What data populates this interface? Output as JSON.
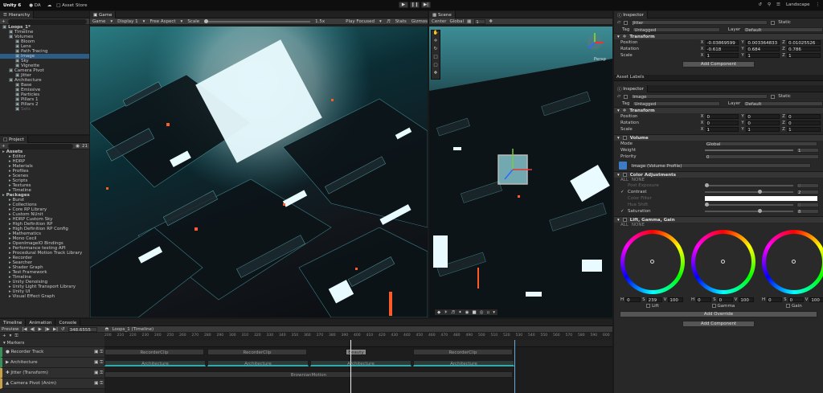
{
  "topbar": {
    "title": "Unity 6",
    "account": "DA",
    "asset_store": "Asset Store",
    "layout": "Landscape"
  },
  "hierarchy": {
    "tab": "Hierarchy",
    "rows": [
      {
        "label": "Loops_1*",
        "indent": 0,
        "bold": true
      },
      {
        "label": "Timeline",
        "indent": 1
      },
      {
        "label": "Volumes",
        "indent": 1
      },
      {
        "label": "Bloom",
        "indent": 2
      },
      {
        "label": "Lens",
        "indent": 2
      },
      {
        "label": "Path Tracing",
        "indent": 2
      },
      {
        "label": "Image",
        "indent": 2,
        "selected": true
      },
      {
        "label": "Sky",
        "indent": 2
      },
      {
        "label": "Vignette",
        "indent": 2
      },
      {
        "label": "Camera Pivot",
        "indent": 1
      },
      {
        "label": "Jitter",
        "indent": 2
      },
      {
        "label": "Architecture",
        "indent": 1
      },
      {
        "label": "Base",
        "indent": 2
      },
      {
        "label": "Emissive",
        "indent": 2
      },
      {
        "label": "Particles",
        "indent": 2
      },
      {
        "label": "Pillars 1",
        "indent": 2
      },
      {
        "label": "Pillars 2",
        "indent": 2
      },
      {
        "label": "Sets",
        "indent": 2,
        "dim": true
      }
    ]
  },
  "project": {
    "tab": "Project",
    "count": "21",
    "rows": [
      {
        "label": "Assets",
        "indent": 0,
        "bold": true
      },
      {
        "label": "Editor",
        "indent": 1
      },
      {
        "label": "HDRP",
        "indent": 1
      },
      {
        "label": "Materials",
        "indent": 1
      },
      {
        "label": "Profiles",
        "indent": 1
      },
      {
        "label": "Scenes",
        "indent": 1
      },
      {
        "label": "Scripts",
        "indent": 1
      },
      {
        "label": "Textures",
        "indent": 1
      },
      {
        "label": "Timeline",
        "indent": 1
      },
      {
        "label": "Packages",
        "indent": 0,
        "bold": true
      },
      {
        "label": "Burst",
        "indent": 1
      },
      {
        "label": "Collections",
        "indent": 1
      },
      {
        "label": "Core RP Library",
        "indent": 1
      },
      {
        "label": "Custom NUnit",
        "indent": 1
      },
      {
        "label": "HDRP Custom Sky",
        "indent": 1
      },
      {
        "label": "High Definition RP",
        "indent": 1
      },
      {
        "label": "High Definition RP Config",
        "indent": 1
      },
      {
        "label": "Mathematics",
        "indent": 1
      },
      {
        "label": "Mono Cecil",
        "indent": 1
      },
      {
        "label": "OpenImageIO Bindings",
        "indent": 1
      },
      {
        "label": "Performance testing API",
        "indent": 1
      },
      {
        "label": "Procedural Motion Track Library",
        "indent": 1
      },
      {
        "label": "Recorder",
        "indent": 1
      },
      {
        "label": "Searcher",
        "indent": 1
      },
      {
        "label": "Shader Graph",
        "indent": 1
      },
      {
        "label": "Test Framework",
        "indent": 1
      },
      {
        "label": "Timeline",
        "indent": 1
      },
      {
        "label": "Unity Denoising",
        "indent": 1
      },
      {
        "label": "Unity Light Transport Library",
        "indent": 1
      },
      {
        "label": "Unity UI",
        "indent": 1
      },
      {
        "label": "Visual Effect Graph",
        "indent": 1
      }
    ]
  },
  "game": {
    "tab": "Game",
    "display_mode": "Game",
    "display": "Display 1",
    "aspect": "Free Aspect",
    "scale_label": "Scale",
    "scale_value": "1.5x",
    "play_mode": "Play Focused",
    "stats": "Stats",
    "gizmos": "Gizmos"
  },
  "scene": {
    "tab": "Scene",
    "pivot": "Center",
    "space": "Global",
    "grid_value": "1",
    "persp": "Persp"
  },
  "inspector1": {
    "tab": "Inspector",
    "object": "Jitter",
    "static": "Static",
    "tag_label": "Tag",
    "tag": "Untagged",
    "layer_label": "Layer",
    "layer": "Default",
    "transform": "Transform",
    "position": {
      "label": "Position",
      "x": "-0.03869599",
      "y": "0.003364833",
      "z": "0.01025526"
    },
    "rotation": {
      "label": "Rotation",
      "x": "-0.618",
      "y": "0.684",
      "z": "0.786"
    },
    "scale": {
      "label": "Scale",
      "x": "1",
      "y": "1",
      "z": "1"
    },
    "add_component": "Add Component"
  },
  "asset_labels": "Asset Labels",
  "inspector2": {
    "tab": "Inspector",
    "object": "Image",
    "static": "Static",
    "tag_label": "Tag",
    "tag": "Untagged",
    "layer_label": "Layer",
    "layer": "Default",
    "transform": "Transform",
    "position": {
      "label": "Position",
      "x": "0",
      "y": "0",
      "z": "0"
    },
    "rotation": {
      "label": "Rotation",
      "x": "0",
      "y": "0",
      "z": "0"
    },
    "scale": {
      "label": "Scale",
      "x": "1",
      "y": "1",
      "z": "1"
    },
    "volume": "Volume",
    "mode": {
      "label": "Mode",
      "value": "Global"
    },
    "weight": {
      "label": "Weight",
      "value": "1"
    },
    "priority": {
      "label": "Priority",
      "value": "0"
    },
    "profile": "Image (Volume Profile)",
    "color_adj": {
      "title": "Color Adjustments",
      "all": "ALL",
      "none": "NONE",
      "rows": [
        {
          "label": "Post Exposure",
          "value": "0",
          "on": false
        },
        {
          "label": "Contrast",
          "value": "2",
          "on": true
        },
        {
          "label": "Color Filter",
          "value": "",
          "on": false
        },
        {
          "label": "Hue Shift",
          "value": "0",
          "on": false
        },
        {
          "label": "Saturation",
          "value": "8",
          "on": true
        }
      ]
    },
    "lgg": {
      "title": "Lift, Gamma, Gain",
      "all": "ALL",
      "none": "NONE",
      "values": [
        {
          "h": "0",
          "s": "239",
          "v": "100"
        },
        {
          "h": "0",
          "s": "0",
          "v": "100"
        },
        {
          "h": "0",
          "s": "0",
          "v": "100"
        }
      ],
      "labels": [
        "Lift",
        "Gamma",
        "Gain"
      ]
    },
    "add_override": "Add Override",
    "add_component": "Add Component"
  },
  "timeline": {
    "tabs": [
      "Timeline",
      "Animation",
      "Console"
    ],
    "preview": "Preview",
    "frame": "348.6555",
    "asset": "Loops_1 (Timeline)",
    "ruler": [
      "200",
      "210",
      "220",
      "230",
      "240",
      "250",
      "260",
      "270",
      "280",
      "290",
      "300",
      "310",
      "320",
      "330",
      "340",
      "350",
      "360",
      "370",
      "380",
      "390",
      "400",
      "410",
      "420",
      "430",
      "440",
      "450",
      "460",
      "470",
      "480",
      "490",
      "500",
      "510",
      "520",
      "530",
      "540",
      "550",
      "560",
      "570",
      "580",
      "590",
      "600"
    ],
    "markers": "Markers",
    "tracks": [
      {
        "label": "Recorder Track",
        "icon": "rec"
      },
      {
        "label": "Architecture",
        "icon": "act"
      },
      {
        "label": "Jitter (Transform)",
        "icon": "trs"
      },
      {
        "label": "Camera Pivot (Anim)",
        "icon": "anim"
      }
    ],
    "clips_recorder": [
      "RecorderClip",
      "RecorderClip",
      "Beauty",
      "RecorderClip"
    ],
    "clips_arch": [
      "Architecture",
      "Architecture",
      "Architecture",
      "Architecture"
    ],
    "clip_jitter": "BrownianMotion"
  }
}
